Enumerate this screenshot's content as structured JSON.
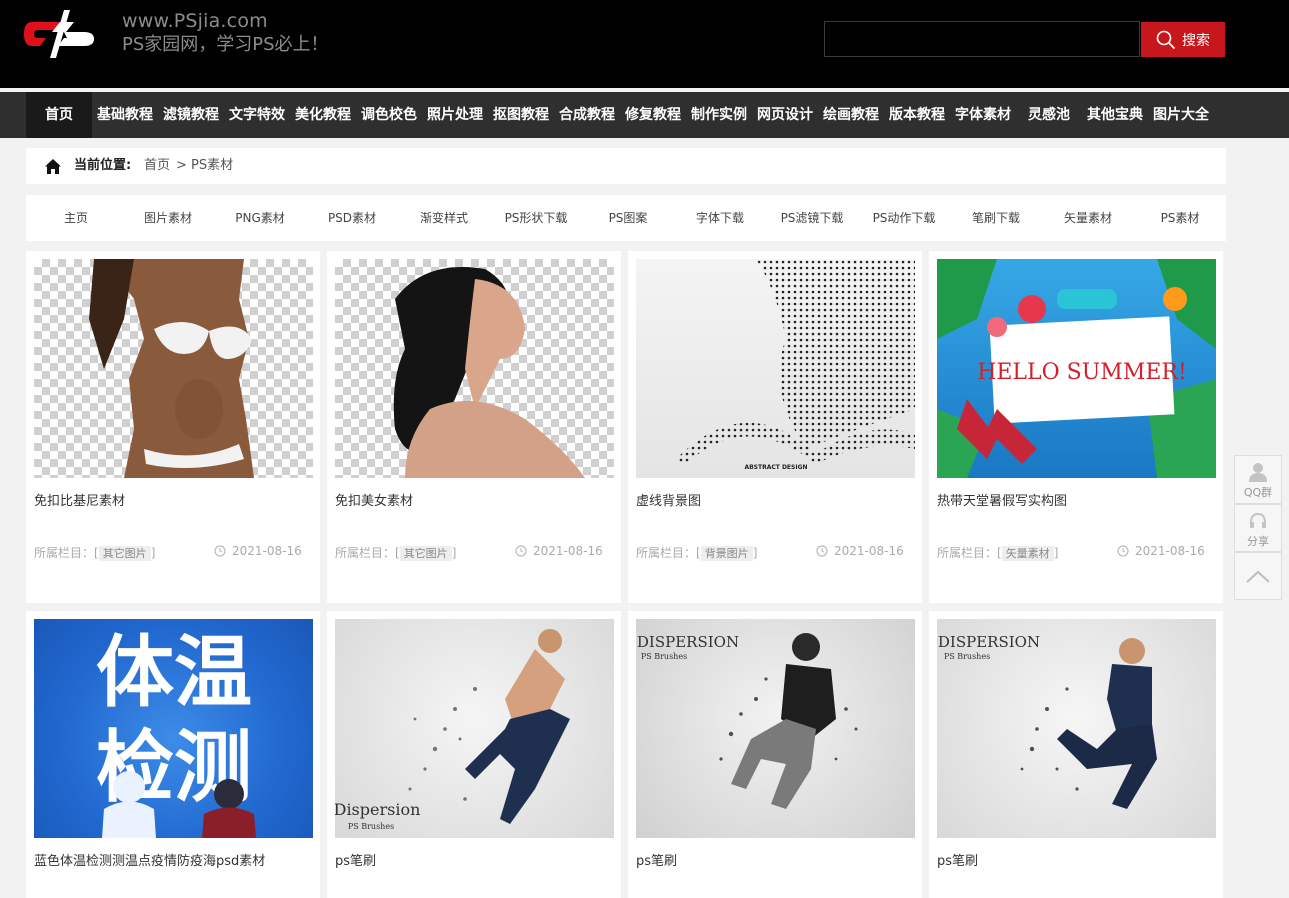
{
  "header": {
    "site_url": "www.PSjia.com",
    "slogan": "PS家园网，学习PS必上！",
    "search_placeholder": "",
    "search_button": "搜索"
  },
  "nav": {
    "items": [
      "首页",
      "基础教程",
      "滤镜教程",
      "文字特效",
      "美化教程",
      "调色校色",
      "照片处理",
      "抠图教程",
      "合成教程",
      "修复教程",
      "制作实例",
      "网页设计",
      "绘画教程",
      "版本教程",
      "字体素材",
      "灵感池",
      "其他宝典",
      "图片大全"
    ],
    "active": "首页"
  },
  "breadcrumb": {
    "label": "当前位置:",
    "home": "首页",
    "separator": ">",
    "current": "PS素材"
  },
  "categories": [
    "主页",
    "图片素材",
    "PNG素材",
    "PSD素材",
    "渐变样式",
    "PS形状下载",
    "PS图案",
    "字体下载",
    "PS滤镜下载",
    "PS动作下载",
    "笔刷下载",
    "矢量素材",
    "PS素材"
  ],
  "cards": [
    {
      "title": "免扣比基尼素材",
      "meta_prefix": "所属栏目：[",
      "tag": "其它图片",
      "meta_suffix": "]",
      "date": "2021-08-16"
    },
    {
      "title": "免扣美女素材",
      "meta_prefix": "所属栏目：[",
      "tag": "其它图片",
      "meta_suffix": "]",
      "date": "2021-08-16"
    },
    {
      "title": "虚线背景图",
      "meta_prefix": "所属栏目：[",
      "tag": "背景图片",
      "meta_suffix": "]",
      "date": "2021-08-16",
      "thumb_text": "ABSTRACT DESIGN"
    },
    {
      "title": "热带天堂暑假写实构图",
      "meta_prefix": "所属栏目：[",
      "tag": "矢量素材",
      "meta_suffix": "]",
      "date": "2021-08-16",
      "thumb_text": "HELLO SUMMER!"
    },
    {
      "title": "蓝色体温检测测温点疫情防疫海psd素材",
      "thumb_text_1": "体温",
      "thumb_text_2": "检测"
    },
    {
      "title": "ps笔刷",
      "thumb_text": "Dispersion",
      "thumb_sub": "PS Brushes"
    },
    {
      "title": "ps笔刷",
      "thumb_text": "DISPERSION",
      "thumb_sub": "PS Brushes"
    },
    {
      "title": "ps笔刷",
      "thumb_text": "DISPERSION",
      "thumb_sub": "PS Brushes"
    }
  ],
  "side_float": {
    "qq_label": "QQ群",
    "share_label": "分享"
  },
  "colors": {
    "accent_red": "#c8161d",
    "header_bg": "#000000",
    "nav_bg": "#2f2f2f"
  }
}
